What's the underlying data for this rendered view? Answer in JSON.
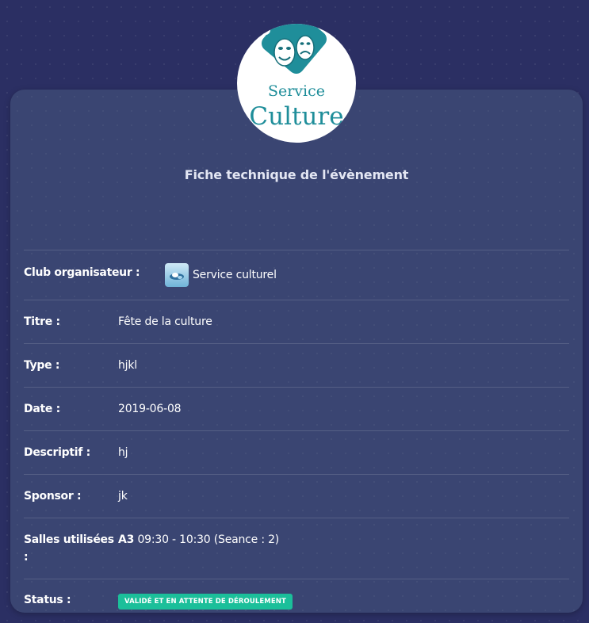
{
  "logo": {
    "line1": "Service",
    "line2": "Culture",
    "colors": {
      "teal": "#1f8e9a",
      "masks": "#1b7d8a"
    }
  },
  "page_title": "Fiche technique de l'évènement",
  "fields": {
    "club": {
      "label": "Club organisateur :",
      "value": "Service culturel",
      "avatar_icon": "club-avatar-icon"
    },
    "titre": {
      "label": "Titre :",
      "value": "Fête de la culture"
    },
    "type": {
      "label": "Type :",
      "value": "hjkl"
    },
    "date": {
      "label": "Date :",
      "value": "2019-06-08"
    },
    "descriptif": {
      "label": "Descriptif :",
      "value": "hj"
    },
    "sponsor": {
      "label": "Sponsor :",
      "value": "jk"
    },
    "salles": {
      "label": "Salles utilisées :",
      "room": "A3",
      "detail": "09:30 - 10:30 (Seance : 2)"
    },
    "status": {
      "label": "Status :",
      "value": "VALIDÉ ET EN ATTENTE DE DÉROULEMENT",
      "color": "#1bbf9a"
    }
  },
  "colors": {
    "background": "#2b2f63",
    "card": "#3a4572",
    "title": "#e3e6f3"
  }
}
